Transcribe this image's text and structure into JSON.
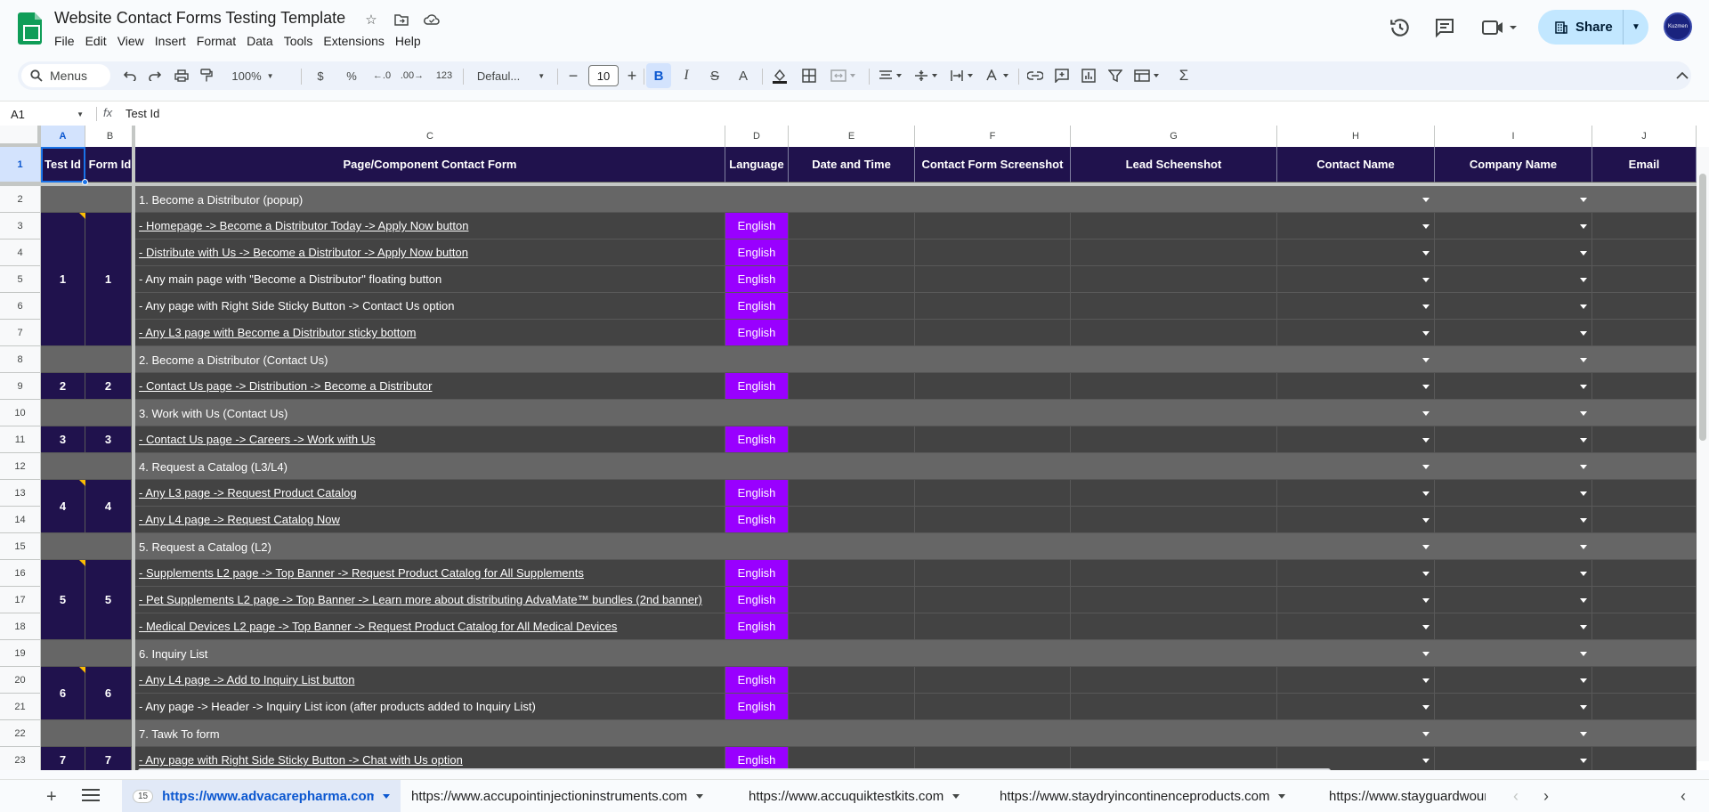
{
  "app": {
    "title": "Website Contact Forms Testing Template",
    "menu": [
      "File",
      "Edit",
      "View",
      "Insert",
      "Format",
      "Data",
      "Tools",
      "Extensions",
      "Help"
    ],
    "share_label": "Share",
    "avatar_text": "Kuzmen"
  },
  "toolbar": {
    "search_label": "Menus",
    "zoom": "100%",
    "currency": "$",
    "percent": "%",
    "dec_decrease": ".0",
    "dec_increase": ".00",
    "number_format": "123",
    "font": "Defaul...",
    "font_size": "10",
    "bold": "B",
    "italic": "I",
    "strike": "S",
    "text_color": "A",
    "sum": "Σ"
  },
  "formula": {
    "cell_ref": "A1",
    "fx": "fx",
    "content": "Test Id"
  },
  "columns": [
    "A",
    "B",
    "C",
    "D",
    "E",
    "F",
    "G",
    "H",
    "I",
    "J"
  ],
  "header_row": [
    "Test Id",
    "Form Id",
    "Page/Component Contact Form",
    "Language",
    "Date and Time",
    "Contact Form Screenshot",
    "Lead Scheenshot",
    "Contact Name",
    "Company Name",
    "Email"
  ],
  "rows": [
    {
      "n": "2",
      "type": "section",
      "text": "1. Become a Distributor (popup)"
    },
    {
      "n": "3",
      "type": "item",
      "text": "- Homepage -> Become a Distributor Today -> Apply Now button",
      "link": true,
      "lang": "English"
    },
    {
      "n": "4",
      "type": "item",
      "text": "- Distribute with Us -> Become a Distributor -> Apply Now button",
      "link": true,
      "lang": "English"
    },
    {
      "n": "5",
      "type": "item",
      "text": "- Any main page with \"Become a Distributor\" floating button",
      "link": false,
      "lang": "English"
    },
    {
      "n": "6",
      "type": "item",
      "text": "- Any page with Right Side Sticky Button -> Contact Us option",
      "link": false,
      "lang": "English"
    },
    {
      "n": "7",
      "type": "item",
      "text": "- Any L3 page with Become a Distributor sticky bottom",
      "link": true,
      "lang": "English"
    },
    {
      "n": "8",
      "type": "section",
      "text": "2. Become a Distributor (Contact Us)"
    },
    {
      "n": "9",
      "type": "item",
      "text": "- Contact Us page -> Distribution -> Become a Distributor",
      "link": true,
      "lang": "English"
    },
    {
      "n": "10",
      "type": "section",
      "text": "3. Work with Us (Contact Us)"
    },
    {
      "n": "11",
      "type": "item",
      "text": "- Contact Us page -> Careers -> Work with Us",
      "link": true,
      "lang": "English"
    },
    {
      "n": "12",
      "type": "section",
      "text": "4. Request a Catalog (L3/L4)"
    },
    {
      "n": "13",
      "type": "item",
      "text": "- Any L3 page -> Request Product Catalog",
      "link": true,
      "lang": "English"
    },
    {
      "n": "14",
      "type": "item",
      "text": "- Any L4 page -> Request Catalog Now",
      "link": true,
      "lang": "English"
    },
    {
      "n": "15",
      "type": "section",
      "text": "5. Request a Catalog (L2)"
    },
    {
      "n": "16",
      "type": "item",
      "text": "- Supplements L2 page -> Top Banner -> Request Product Catalog for All Supplements",
      "link": true,
      "lang": "English"
    },
    {
      "n": "17",
      "type": "item",
      "text": "- Pet Supplements L2 page -> Top Banner -> Learn more about distributing AdvaMate™ bundles (2nd banner)",
      "link": true,
      "lang": "English"
    },
    {
      "n": "18",
      "type": "item",
      "text": "- Medical Devices L2 page -> Top Banner -> Request Product Catalog for All Medical Devices",
      "link": true,
      "lang": "English"
    },
    {
      "n": "19",
      "type": "section",
      "text": "6. Inquiry List"
    },
    {
      "n": "20",
      "type": "item",
      "text": "- Any L4 page -> Add to Inquiry List button",
      "link": true,
      "lang": "English"
    },
    {
      "n": "21",
      "type": "item",
      "text": "- Any page -> Header -> Inquiry List icon (after products added to Inquiry List)",
      "link": false,
      "lang": "English"
    },
    {
      "n": "22",
      "type": "section",
      "text": "7. Tawk To form"
    },
    {
      "n": "23",
      "type": "item",
      "text": "- Any page with Right Side Sticky Button -> Chat with Us option",
      "link": true,
      "lang": "English"
    }
  ],
  "groups": [
    {
      "rows": [
        "3",
        "4",
        "5",
        "6",
        "7"
      ],
      "test_id": "1",
      "form_id": "1"
    },
    {
      "rows": [
        "9"
      ],
      "test_id": "2",
      "form_id": "2"
    },
    {
      "rows": [
        "11"
      ],
      "test_id": "3",
      "form_id": "3"
    },
    {
      "rows": [
        "13",
        "14"
      ],
      "test_id": "4",
      "form_id": "4"
    },
    {
      "rows": [
        "16",
        "17",
        "18"
      ],
      "test_id": "5",
      "form_id": "5"
    },
    {
      "rows": [
        "20",
        "21"
      ],
      "test_id": "6",
      "form_id": "6"
    },
    {
      "rows": [
        "23"
      ],
      "test_id": "7",
      "form_id": "7"
    }
  ],
  "sheets": [
    {
      "num": "15",
      "label": "https://www.advacarepharma.com",
      "active": true
    },
    {
      "label": "https://www.accupointinjectioninstruments.com",
      "active": false
    },
    {
      "label": "https://www.accuquiktestkits.com",
      "active": false
    },
    {
      "label": "https://www.staydryincontinenceproducts.com",
      "active": false
    },
    {
      "label": "https://www.stayguardwoun",
      "active": false
    }
  ],
  "colors": {
    "header_bg": "#20124d",
    "section_bg": "#666666",
    "row_bg": "#434343",
    "language_bg": "#9900ff",
    "accent": "#1a73e8"
  }
}
